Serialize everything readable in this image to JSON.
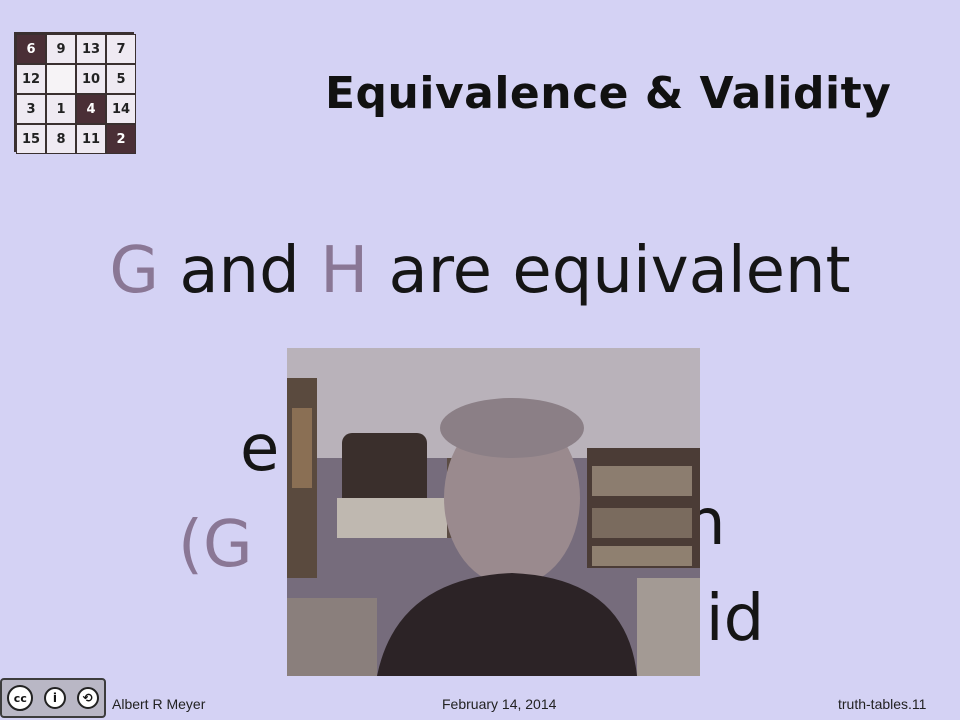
{
  "puzzle": {
    "tiles": [
      {
        "label": "6",
        "dark": true
      },
      {
        "label": "9",
        "dark": false
      },
      {
        "label": "13",
        "dark": false
      },
      {
        "label": "7",
        "dark": false
      },
      {
        "label": "12",
        "dark": false
      },
      {
        "label": "",
        "dark": false
      },
      {
        "label": "10",
        "dark": false
      },
      {
        "label": "5",
        "dark": false
      },
      {
        "label": "3",
        "dark": false
      },
      {
        "label": "1",
        "dark": false
      },
      {
        "label": "4",
        "dark": true
      },
      {
        "label": "14",
        "dark": false
      },
      {
        "label": "15",
        "dark": false
      },
      {
        "label": "8",
        "dark": false
      },
      {
        "label": "11",
        "dark": false
      },
      {
        "label": "2",
        "dark": true
      }
    ]
  },
  "slide": {
    "title": "Equivalence & Validity",
    "line1": {
      "g": "G",
      "and": " and ",
      "h": "H",
      "rest": " are equivalent"
    },
    "line2": {
      "left": "e",
      "right": "n"
    },
    "line3": {
      "left": "(G",
      "right": "lid"
    }
  },
  "license": {
    "cc": "cc",
    "by": "BY",
    "sa": "SA"
  },
  "footer": {
    "author": "Albert R Meyer",
    "date": "February 14, 2014",
    "slide_id": "truth-tables.11"
  },
  "colors": {
    "background": "#d4d2f4",
    "variable": "#8a7795",
    "tile_dark": "#4a2f36"
  }
}
